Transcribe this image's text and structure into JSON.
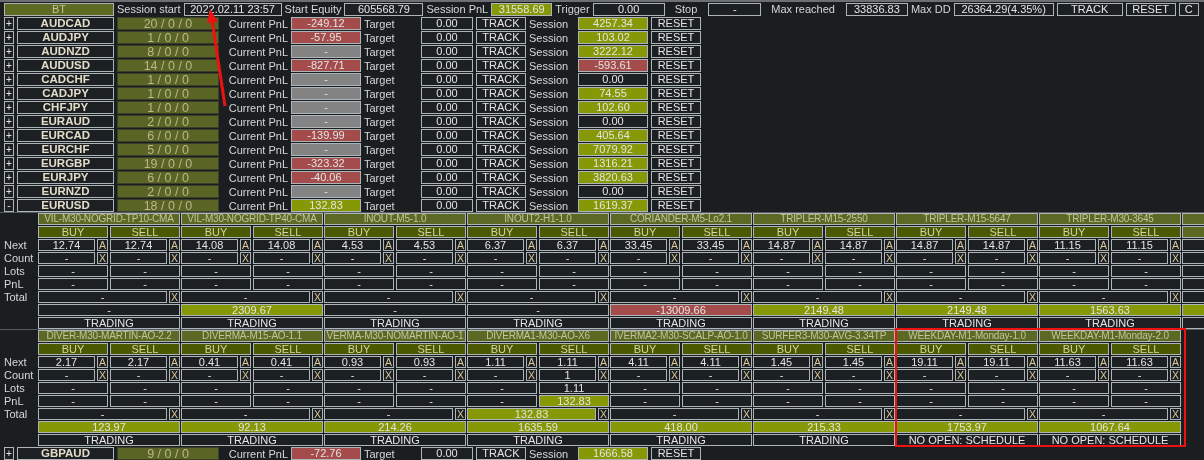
{
  "header": {
    "mode": "BT",
    "session_start_label": "Session start",
    "session_start": "2022.02.11 23:57",
    "start_equity_label": "Start Equity",
    "start_equity": "605568.79",
    "session_pnl_label": "Session PnL",
    "session_pnl": {
      "value": "31558.69",
      "color": "#869806"
    },
    "trigger_label": "Trigger",
    "trigger": "0.00",
    "stop_label": "Stop",
    "stop": "-",
    "max_reached_label": "Max reached",
    "max_reached": "33836.83",
    "max_dd_label": "Max DD",
    "max_dd": "26364.29(4.35%)",
    "track": "TRACK",
    "reset": "RESET",
    "cut_button": "C"
  },
  "symbols": [
    {
      "toggle": "+",
      "name": "AUDCAD",
      "counts": "20 / 0 / 0",
      "pnl_label": "Current PnL",
      "pnl": {
        "value": "-249.12",
        "color": "#a44c4c"
      },
      "target_label": "Target",
      "target": "0.00",
      "track": "TRACK",
      "session_label": "Session",
      "session": {
        "value": "4257.34",
        "color": "#869806"
      },
      "reset": "RESET"
    },
    {
      "toggle": "+",
      "name": "AUDJPY",
      "counts": "1 / 0 / 0",
      "pnl_label": "Current PnL",
      "pnl": {
        "value": "-57.95",
        "color": "#a44c4c"
      },
      "target_label": "Target",
      "target": "0.00",
      "track": "TRACK",
      "session_label": "Session",
      "session": {
        "value": "103.02",
        "color": "#869806"
      },
      "reset": "RESET"
    },
    {
      "toggle": "+",
      "name": "AUDNZD",
      "counts": "8 / 0 / 0",
      "pnl_label": "Current PnL",
      "pnl": {
        "value": "-",
        "color": "#838383"
      },
      "target_label": "Target",
      "target": "0.00",
      "track": "TRACK",
      "session_label": "Session",
      "session": {
        "value": "3222.12",
        "color": "#869806"
      },
      "reset": "RESET"
    },
    {
      "toggle": "+",
      "name": "AUDUSD",
      "counts": "14 / 0 / 0",
      "pnl_label": "Current PnL",
      "pnl": {
        "value": "-827.71",
        "color": "#a44c4c"
      },
      "target_label": "Target",
      "target": "0.00",
      "track": "TRACK",
      "session_label": "Session",
      "session": {
        "value": "-593.61",
        "color": "#a44c4c"
      },
      "reset": "RESET"
    },
    {
      "toggle": "+",
      "name": "CADCHF",
      "counts": "1 / 0 / 0",
      "pnl_label": "Current PnL",
      "pnl": {
        "value": "-",
        "color": "#838383"
      },
      "target_label": "Target",
      "target": "0.00",
      "track": "TRACK",
      "session_label": "Session",
      "session": {
        "value": "0.00",
        "color": "#1d2023"
      },
      "reset": "RESET"
    },
    {
      "toggle": "+",
      "name": "CADJPY",
      "counts": "1 / 0 / 0",
      "pnl_label": "Current PnL",
      "pnl": {
        "value": "-",
        "color": "#838383"
      },
      "target_label": "Target",
      "target": "0.00",
      "track": "TRACK",
      "session_label": "Session",
      "session": {
        "value": "74.55",
        "color": "#869806"
      },
      "reset": "RESET"
    },
    {
      "toggle": "+",
      "name": "CHFJPY",
      "counts": "1 / 0 / 0",
      "pnl_label": "Current PnL",
      "pnl": {
        "value": "-",
        "color": "#838383"
      },
      "target_label": "Target",
      "target": "0.00",
      "track": "TRACK",
      "session_label": "Session",
      "session": {
        "value": "102.60",
        "color": "#869806"
      },
      "reset": "RESET"
    },
    {
      "toggle": "+",
      "name": "EURAUD",
      "counts": "2 / 0 / 0",
      "pnl_label": "Current PnL",
      "pnl": {
        "value": "-",
        "color": "#838383"
      },
      "target_label": "Target",
      "target": "0.00",
      "track": "TRACK",
      "session_label": "Session",
      "session": {
        "value": "0.00",
        "color": "#1d2023"
      },
      "reset": "RESET"
    },
    {
      "toggle": "+",
      "name": "EURCAD",
      "counts": "6 / 0 / 0",
      "pnl_label": "Current PnL",
      "pnl": {
        "value": "-139.99",
        "color": "#a44c4c"
      },
      "target_label": "Target",
      "target": "0.00",
      "track": "TRACK",
      "session_label": "Session",
      "session": {
        "value": "405.64",
        "color": "#869806"
      },
      "reset": "RESET"
    },
    {
      "toggle": "+",
      "name": "EURCHF",
      "counts": "5 / 0 / 0",
      "pnl_label": "Current PnL",
      "pnl": {
        "value": "-",
        "color": "#838383"
      },
      "target_label": "Target",
      "target": "0.00",
      "track": "TRACK",
      "session_label": "Session",
      "session": {
        "value": "7079.92",
        "color": "#869806"
      },
      "reset": "RESET"
    },
    {
      "toggle": "+",
      "name": "EURGBP",
      "counts": "19 / 0 / 0",
      "pnl_label": "Current PnL",
      "pnl": {
        "value": "-323.32",
        "color": "#a44c4c"
      },
      "target_label": "Target",
      "target": "0.00",
      "track": "TRACK",
      "session_label": "Session",
      "session": {
        "value": "1316.21",
        "color": "#869806"
      },
      "reset": "RESET"
    },
    {
      "toggle": "+",
      "name": "EURJPY",
      "counts": "6 / 0 / 0",
      "pnl_label": "Current PnL",
      "pnl": {
        "value": "-40.06",
        "color": "#a44c4c"
      },
      "target_label": "Target",
      "target": "0.00",
      "track": "TRACK",
      "session_label": "Session",
      "session": {
        "value": "3820.63",
        "color": "#869806"
      },
      "reset": "RESET"
    },
    {
      "toggle": "+",
      "name": "EURNZD",
      "counts": "2 / 0 / 0",
      "pnl_label": "Current PnL",
      "pnl": {
        "value": "-",
        "color": "#838383"
      },
      "target_label": "Target",
      "target": "0.00",
      "track": "TRACK",
      "session_label": "Session",
      "session": {
        "value": "0.00",
        "color": "#1d2023"
      },
      "reset": "RESET"
    },
    {
      "toggle": "-",
      "name": "EURUSD",
      "counts": "18 / 0 / 0",
      "pnl_label": "Current PnL",
      "pnl": {
        "value": "132.83",
        "color": "#869806"
      },
      "target_label": "Target",
      "target": "0.00",
      "track": "TRACK",
      "session_label": "Session",
      "session": {
        "value": "1619.37",
        "color": "#869806"
      },
      "reset": "RESET"
    }
  ],
  "strategy_blocks": [
    {
      "row_labels": [
        "Next",
        "Count",
        "Lots",
        "PnL",
        "Total"
      ],
      "strategies": [
        {
          "name": "VIL-M30-NOGRID-TP10-CMA",
          "buy_label": "BUY",
          "sell_label": "SELL",
          "buy": {
            "next": "12.74",
            "auto": "A",
            "count": "-",
            "close": "X",
            "lots": "-",
            "pnl": {
              "value": "-",
              "color": "#1d2023"
            }
          },
          "sell": {
            "next": "12.74",
            "auto": "A",
            "count": "-",
            "close": "X",
            "lots": "-",
            "pnl": {
              "value": "-",
              "color": "#1d2023"
            }
          },
          "total": {
            "value": "-",
            "color": "#1d2023"
          },
          "total_close": "X",
          "result": {
            "value": "-",
            "color": "#1d2023"
          },
          "status": "TRADING"
        },
        {
          "name": "VIL-M30-NOGRID-TP40-CMA",
          "buy_label": "BUY",
          "sell_label": "SELL",
          "buy": {
            "next": "14.08",
            "auto": "A",
            "count": "-",
            "close": "X",
            "lots": "-",
            "pnl": {
              "value": "-",
              "color": "#1d2023"
            }
          },
          "sell": {
            "next": "14.08",
            "auto": "A",
            "count": "-",
            "close": "X",
            "lots": "-",
            "pnl": {
              "value": "-",
              "color": "#1d2023"
            }
          },
          "total": {
            "value": "-",
            "color": "#1d2023"
          },
          "total_close": "X",
          "result": {
            "value": "2309.67",
            "color": "#869806"
          },
          "status": "TRADING"
        },
        {
          "name": "INOUT-M5-1.0",
          "buy_label": "BUY",
          "sell_label": "SELL",
          "buy": {
            "next": "4.53",
            "auto": "A",
            "count": "-",
            "close": "X",
            "lots": "-",
            "pnl": {
              "value": "-",
              "color": "#1d2023"
            }
          },
          "sell": {
            "next": "4.53",
            "auto": "A",
            "count": "-",
            "close": "X",
            "lots": "-",
            "pnl": {
              "value": "-",
              "color": "#1d2023"
            }
          },
          "total": {
            "value": "-",
            "color": "#1d2023"
          },
          "total_close": "X",
          "result": {
            "value": "-",
            "color": "#1d2023"
          },
          "status": "TRADING"
        },
        {
          "name": "INOUT2-H1-1.0",
          "buy_label": "BUY",
          "sell_label": "SELL",
          "buy": {
            "next": "6.37",
            "auto": "A",
            "count": "-",
            "close": "X",
            "lots": "-",
            "pnl": {
              "value": "-",
              "color": "#1d2023"
            }
          },
          "sell": {
            "next": "6.37",
            "auto": "A",
            "count": "-",
            "close": "X",
            "lots": "-",
            "pnl": {
              "value": "-",
              "color": "#1d2023"
            }
          },
          "total": {
            "value": "-",
            "color": "#1d2023"
          },
          "total_close": "X",
          "result": {
            "value": "-",
            "color": "#1d2023"
          },
          "status": "TRADING"
        },
        {
          "name": "CORIANDER-M5-Lo2.1",
          "buy_label": "BUY",
          "sell_label": "SELL",
          "buy": {
            "next": "33.45",
            "auto": "A",
            "count": "-",
            "close": "X",
            "lots": "-",
            "pnl": {
              "value": "-",
              "color": "#1d2023"
            }
          },
          "sell": {
            "next": "33.45",
            "auto": "A",
            "count": "-",
            "close": "X",
            "lots": "-",
            "pnl": {
              "value": "-",
              "color": "#1d2023"
            }
          },
          "total": {
            "value": "-",
            "color": "#1d2023"
          },
          "total_close": "X",
          "result": {
            "value": "-13009.66",
            "color": "#a44c4c"
          },
          "status": "TRADING"
        },
        {
          "name": "TRIPLER-M15-2550",
          "buy_label": "BUY",
          "sell_label": "SELL",
          "buy": {
            "next": "14.87",
            "auto": "A",
            "count": "-",
            "close": "X",
            "lots": "-",
            "pnl": {
              "value": "-",
              "color": "#1d2023"
            }
          },
          "sell": {
            "next": "14.87",
            "auto": "A",
            "count": "-",
            "close": "X",
            "lots": "-",
            "pnl": {
              "value": "-",
              "color": "#1d2023"
            }
          },
          "total": {
            "value": "-",
            "color": "#1d2023"
          },
          "total_close": "X",
          "result": {
            "value": "2149.48",
            "color": "#869806"
          },
          "status": "TRADING"
        },
        {
          "name": "TRIPLER-M15-5647",
          "buy_label": "BUY",
          "sell_label": "SELL",
          "buy": {
            "next": "14.87",
            "auto": "A",
            "count": "-",
            "close": "X",
            "lots": "-",
            "pnl": {
              "value": "-",
              "color": "#1d2023"
            }
          },
          "sell": {
            "next": "14.87",
            "auto": "A",
            "count": "-",
            "close": "X",
            "lots": "-",
            "pnl": {
              "value": "-",
              "color": "#1d2023"
            }
          },
          "total": {
            "value": "-",
            "color": "#1d2023"
          },
          "total_close": "X",
          "result": {
            "value": "2149.48",
            "color": "#869806"
          },
          "status": "TRADING"
        },
        {
          "name": "TRIPLER-M30-3645",
          "buy_label": "BUY",
          "sell_label": "SELL",
          "buy": {
            "next": "11.15",
            "auto": "A",
            "count": "-",
            "close": "X",
            "lots": "-",
            "pnl": {
              "value": "-",
              "color": "#1d2023"
            }
          },
          "sell": {
            "next": "11.15",
            "auto": "A",
            "count": "-",
            "close": "X",
            "lots": "-",
            "pnl": {
              "value": "-",
              "color": "#1d2023"
            }
          },
          "total": {
            "value": "-",
            "color": "#1d2023"
          },
          "total_close": "X",
          "result": {
            "value": "1563.63",
            "color": "#869806"
          },
          "status": "TRADING"
        }
      ]
    },
    {
      "row_labels": [
        "Next",
        "Count",
        "Lots",
        "PnL",
        "Total"
      ],
      "strategies": [
        {
          "name": "DIVER-M30-MARTIN-AO-2.2",
          "buy_label": "BUY",
          "sell_label": "SELL",
          "buy": {
            "next": "2.17",
            "auto": "A",
            "count": "-",
            "close": "X",
            "lots": "-",
            "pnl": {
              "value": "-",
              "color": "#1d2023"
            }
          },
          "sell": {
            "next": "2.17",
            "auto": "A",
            "count": "-",
            "close": "X",
            "lots": "-",
            "pnl": {
              "value": "-",
              "color": "#1d2023"
            }
          },
          "total": {
            "value": "-",
            "color": "#1d2023"
          },
          "total_close": "X",
          "result": {
            "value": "123.97",
            "color": "#869806"
          },
          "status": "TRADING"
        },
        {
          "name": "DIVERMA-M15-AO-1.1",
          "buy_label": "BUY",
          "sell_label": "SELL",
          "buy": {
            "next": "0.41",
            "auto": "A",
            "count": "-",
            "close": "X",
            "lots": "-",
            "pnl": {
              "value": "-",
              "color": "#1d2023"
            }
          },
          "sell": {
            "next": "0.41",
            "auto": "A",
            "count": "-",
            "close": "X",
            "lots": "-",
            "pnl": {
              "value": "-",
              "color": "#1d2023"
            }
          },
          "total": {
            "value": "-",
            "color": "#1d2023"
          },
          "total_close": "X",
          "result": {
            "value": "92.13",
            "color": "#869806"
          },
          "status": "TRADING"
        },
        {
          "name": "VERMA-M30-NOMARTIN-AO-1",
          "buy_label": "BUY",
          "sell_label": "SELL",
          "buy": {
            "next": "0.93",
            "auto": "A",
            "count": "-",
            "close": "X",
            "lots": "-",
            "pnl": {
              "value": "-",
              "color": "#1d2023"
            }
          },
          "sell": {
            "next": "0.93",
            "auto": "A",
            "count": "-",
            "close": "X",
            "lots": "-",
            "pnl": {
              "value": "-",
              "color": "#1d2023"
            }
          },
          "total": {
            "value": "-",
            "color": "#1d2023"
          },
          "total_close": "X",
          "result": {
            "value": "214.26",
            "color": "#869806"
          },
          "status": "TRADING"
        },
        {
          "name": "DIVERMA1-M30-AO-X6",
          "buy_label": "BUY",
          "sell_label": "SELL",
          "buy": {
            "next": "1.11",
            "auto": "A",
            "count": "-",
            "close": "X",
            "lots": "-",
            "pnl": {
              "value": "-",
              "color": "#1d2023"
            }
          },
          "sell": {
            "next": "1.11",
            "auto": "A",
            "count": "1",
            "close": "X",
            "lots": "1.11",
            "pnl": {
              "value": "132.83",
              "color": "#869806"
            }
          },
          "total": {
            "value": "132.83",
            "color": "#869806"
          },
          "total_close": "X",
          "result": {
            "value": "1635.59",
            "color": "#869806"
          },
          "status": "TRADING"
        },
        {
          "name": "IVERMA2-M30-SCALP-AO-1.0",
          "buy_label": "BUY",
          "sell_label": "SELL",
          "buy": {
            "next": "4.11",
            "auto": "A",
            "count": "-",
            "close": "X",
            "lots": "-",
            "pnl": {
              "value": "-",
              "color": "#1d2023"
            }
          },
          "sell": {
            "next": "4.11",
            "auto": "A",
            "count": "-",
            "close": "X",
            "lots": "-",
            "pnl": {
              "value": "-",
              "color": "#1d2023"
            }
          },
          "total": {
            "value": "-",
            "color": "#1d2023"
          },
          "total_close": "X",
          "result": {
            "value": "418.00",
            "color": "#869806"
          },
          "status": "TRADING"
        },
        {
          "name": "SURFER3-M30-AVG-3.34TP",
          "buy_label": "BUY",
          "sell_label": "SELL",
          "buy": {
            "next": "1.45",
            "auto": "A",
            "count": "-",
            "close": "X",
            "lots": "-",
            "pnl": {
              "value": "-",
              "color": "#1d2023"
            }
          },
          "sell": {
            "next": "1.45",
            "auto": "A",
            "count": "-",
            "close": "X",
            "lots": "-",
            "pnl": {
              "value": "-",
              "color": "#1d2023"
            }
          },
          "total": {
            "value": "-",
            "color": "#1d2023"
          },
          "total_close": "X",
          "result": {
            "value": "215.33",
            "color": "#869806"
          },
          "status": "TRADING"
        },
        {
          "name": "WEEKDAY-M1-Monday-1.0",
          "buy_label": "BUY",
          "sell_label": "SELL",
          "buy": {
            "next": "19.11",
            "auto": "A",
            "count": "-",
            "close": "X",
            "lots": "-",
            "pnl": {
              "value": "-",
              "color": "#1d2023"
            }
          },
          "sell": {
            "next": "19.11",
            "auto": "A",
            "count": "-",
            "close": "X",
            "lots": "-",
            "pnl": {
              "value": "-",
              "color": "#1d2023"
            }
          },
          "total": {
            "value": "-",
            "color": "#1d2023"
          },
          "total_close": "X",
          "result": {
            "value": "1753.97",
            "color": "#869806"
          },
          "status": "NO OPEN: SCHEDULE"
        },
        {
          "name": "WEEKDAY-M1-Monday-2.0",
          "buy_label": "BUY",
          "sell_label": "SELL",
          "buy": {
            "next": "11.63",
            "auto": "A",
            "count": "-",
            "close": "X",
            "lots": "-",
            "pnl": {
              "value": "-",
              "color": "#1d2023"
            }
          },
          "sell": {
            "next": "11.63",
            "auto": "A",
            "count": "-",
            "close": "X",
            "lots": "-",
            "pnl": {
              "value": "-",
              "color": "#1d2023"
            }
          },
          "total": {
            "value": "-",
            "color": "#1d2023"
          },
          "total_close": "X",
          "result": {
            "value": "1067.64",
            "color": "#869806"
          },
          "status": "NO OPEN: SCHEDULE"
        }
      ]
    }
  ],
  "more_symbols": [
    {
      "toggle": "+",
      "name": "GBPAUD",
      "counts": "9 / 0 / 0",
      "pnl_label": "Current PnL",
      "pnl": {
        "value": "-72.76",
        "color": "#a44c4c"
      },
      "target_label": "Target",
      "target": "0.00",
      "track": "TRACK",
      "session_label": "Session",
      "session": {
        "value": "1666.58",
        "color": "#869806"
      },
      "reset": "RESET"
    }
  ],
  "annotations": {
    "arrow": true,
    "frame": true
  }
}
